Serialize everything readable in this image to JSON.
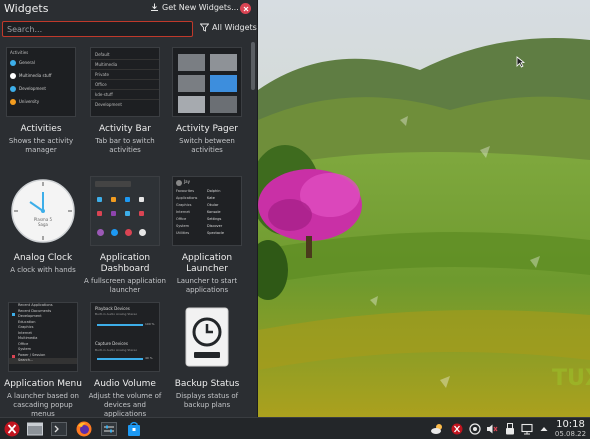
{
  "panel": {
    "title": "Widgets",
    "get_new_label": "Get New Widgets...",
    "search_placeholder": "Search...",
    "filter_label": "All Widgets"
  },
  "widgets": [
    {
      "title": "Activities",
      "desc": "Shows the activity manager"
    },
    {
      "title": "Activity Bar",
      "desc": "Tab bar to switch activities"
    },
    {
      "title": "Activity Pager",
      "desc": "Switch between activities"
    },
    {
      "title": "Analog Clock",
      "desc": "A clock with hands"
    },
    {
      "title": "Application Dashboard",
      "desc": "A fullscreen application launcher"
    },
    {
      "title": "Application Launcher",
      "desc": "Launcher to start applications"
    },
    {
      "title": "Application Menu",
      "desc": "A launcher based on cascading popup menus"
    },
    {
      "title": "Audio Volume",
      "desc": "Adjust the volume of devices and applications"
    },
    {
      "title": "Backup Status",
      "desc": "Displays status of backup plans"
    }
  ],
  "thumb_activities": {
    "heading": "Activities",
    "items": [
      "General",
      "Multimedia stuff",
      "Development",
      "University"
    ]
  },
  "thumb_activity_bar": {
    "items": [
      "Default",
      "Multimedia",
      "Private",
      "Office",
      "kde-stuff",
      "Development"
    ]
  },
  "thumb_app_menu": {
    "items": [
      "Recent Applications",
      "Recent Documents",
      "Development",
      "Education",
      "Graphics",
      "Internet",
      "Multimedia",
      "Office",
      "System",
      "Power / Session",
      "Search..."
    ]
  },
  "thumb_audio": {
    "playback_heading": "Playback Devices",
    "playback_device": "Built-in Audio Analog Stereo",
    "playback_level": "100 %",
    "capture_heading": "Capture Devices",
    "capture_device": "Built-in Audio Analog Stereo",
    "capture_level": "40 %"
  },
  "thumb_analog_clock": {
    "line1": "Plasma 5",
    "line2": "Saga"
  },
  "thumb_launcher": {
    "user": "Jay",
    "categories": [
      "Favourites",
      "Applications",
      "Graphics",
      "Internet",
      "Office",
      "System",
      "Utilities"
    ],
    "apps": [
      "Dolphin",
      "Kate",
      "Okular",
      "Konsole",
      "Settings",
      "Discover",
      "Spectacle"
    ]
  },
  "taskbar": {
    "clock_time": "10:18",
    "clock_date": "05.08.22"
  },
  "wallpaper": {
    "watermark": "TUX"
  },
  "colors": {
    "panel_bg": "#2b2e32",
    "taskbar_bg": "#232629",
    "accent_red": "#da4453",
    "accent_blue": "#3daee9"
  }
}
